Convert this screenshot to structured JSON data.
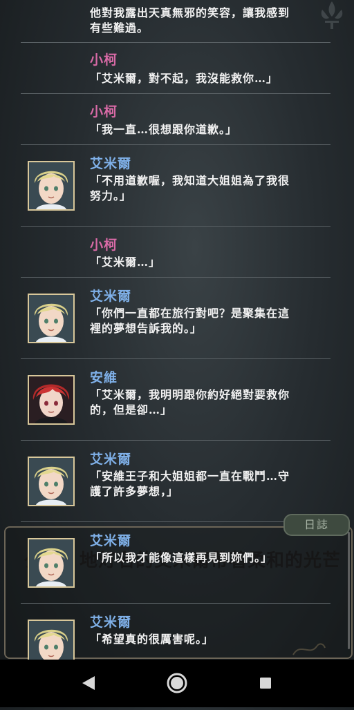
{
  "top_partial_line": "他對我露出天真無邪的笑容，讓我感到有些難過。",
  "entries": [
    {
      "speaker": "小柯",
      "text": "「艾米爾，對不起，我沒能救你…」",
      "color": "pink"
    },
    {
      "speaker": "小柯",
      "text": "「我一直…很想跟你道歉。」",
      "color": "pink"
    },
    {
      "speaker": "艾米爾",
      "text": "「不用道歉喔，我知道大姐姐為了我很努力。」",
      "color": "blue",
      "portrait": "emil"
    },
    {
      "speaker": "小柯",
      "text": "「艾米爾…」",
      "color": "pink"
    },
    {
      "speaker": "艾米爾",
      "text": "「你們一直都在旅行對吧？是聚集在這裡的夢想告訴我的。」",
      "color": "blue",
      "portrait": "emil"
    },
    {
      "speaker": "安維",
      "text": "「艾米爾，我明明跟你約好絕對要救你的，但是卻…」",
      "color": "blue",
      "portrait": "anvi"
    },
    {
      "speaker": "艾米爾",
      "text": "「安維王子和大姐姐都一直在戰鬥…守護了許多夢想，」",
      "color": "blue",
      "portrait": "emil"
    },
    {
      "speaker": "艾米爾",
      "text": "「所以我才能像這樣再見到妳們。」",
      "color": "blue",
      "portrait": "emil"
    },
    {
      "speaker": "艾米爾",
      "text": "「希望真的很厲害呢。」",
      "color": "blue",
      "portrait": "emil"
    }
  ],
  "background_dialog_text": "ダ　　地灯名的艾米爾帶著柔和的光芒",
  "diary_button_label": "日誌",
  "colors": {
    "pink": "#d86aa6",
    "blue": "#7fb0e8"
  },
  "nav": {
    "back": "back-icon",
    "home": "home-icon",
    "recents": "recents-icon"
  }
}
